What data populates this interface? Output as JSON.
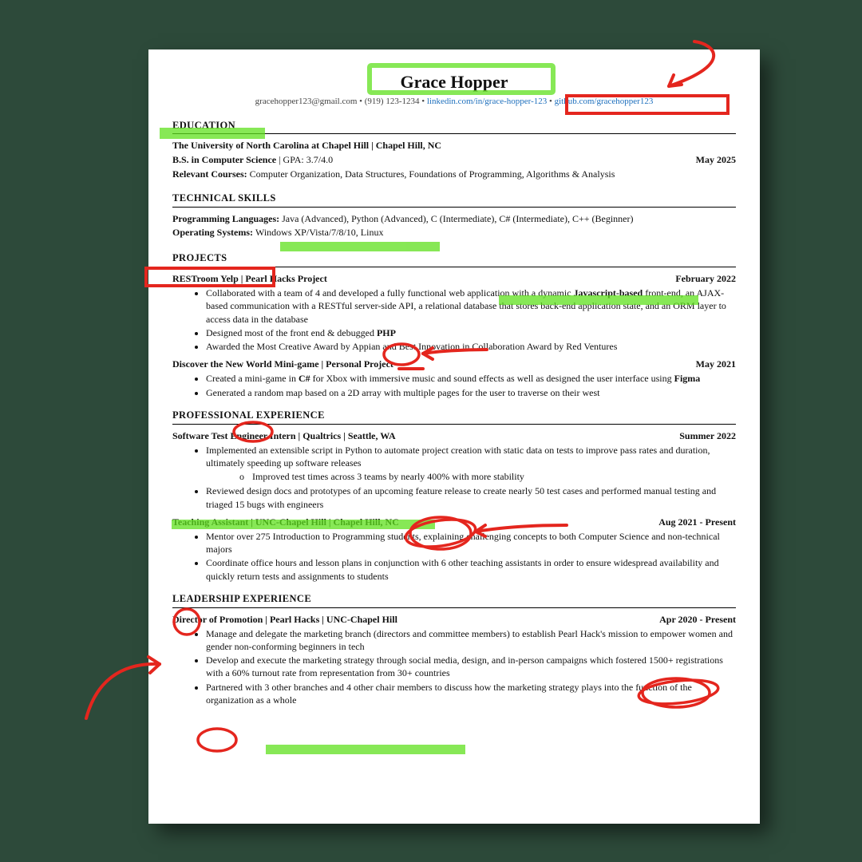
{
  "header": {
    "name": "Grace Hopper",
    "email": "gracehopper123@gmail.com",
    "phone": "(919) 123-1234",
    "linkedin_text": "linkedin.com/in/grace-hopper-123",
    "github_text": "github.com/gracehopper123",
    "sep": " • "
  },
  "sections": {
    "education": {
      "title": "EDUCATION",
      "school_line": "The University of North Carolina at Chapel Hill | Chapel Hill, NC",
      "degree_line_label": "B.S. in Computer Science",
      "gpa_label": " | GPA: ",
      "gpa_value": "3.7/4.0",
      "date": "May 2025",
      "courses_label": "Relevant Courses: ",
      "courses": "Computer Organization, Data Structures, Foundations of Programming, Algorithms & Analysis"
    },
    "skills": {
      "title": "TECHNICAL SKILLS",
      "langs_label": "Programming Languages:  ",
      "langs": "Java (Advanced), Python (Advanced), C (Intermediate), C# (Intermediate), C++ (Beginner)",
      "os_label": "Operating Systems: ",
      "os": "Windows XP/Vista/7/8/10, Linux"
    },
    "projects": {
      "title": "PROJECTS",
      "p1": {
        "heading": "RESTroom Yelp | Pearl Hacks Project",
        "date": "February 2022",
        "b1a": "Collaborated with a team of 4 and developed a fully functional web application with a dynamic ",
        "b1b_bold": "Javascript-based",
        "b1c": " front-end, an AJAX-based communication with a RESTful server-side API, a relational database that stores back-end application state, and an ORM layer to access data in the database",
        "b2a": "Designed most of the front end & debugged ",
        "b2b_bold": "PHP",
        "b3": "Awarded the Most Creative Award by Appian and Best Innovation in Collaboration Award by Red Ventures"
      },
      "p2": {
        "heading": "Discover the New World Mini-game | Personal Project",
        "date": "May 2021",
        "b1a": "Created a mini-game in ",
        "b1b_bold": "C#",
        "b1c": " for Xbox with immersive music and sound effects as well as designed the user interface using ",
        "b1d_bold": "Figma",
        "b2": "Generated a random map based on a 2D array with multiple pages for the user to traverse on their west"
      }
    },
    "experience": {
      "title": "PROFESSIONAL EXPERIENCE",
      "e1": {
        "heading": "Software Test Engineer Intern | Qualtrics | Seattle, WA",
        "date": "Summer 2022",
        "b1": "Implemented an extensible script in Python to automate project creation with static data on tests to improve pass rates and duration, ultimately speeding up software releases",
        "b1_sub": "Improved test times across 3 teams by nearly 400% with more stability",
        "b2": "Reviewed design docs and prototypes of an upcoming feature release to create nearly 50 test cases and performed manual testing and triaged 15 bugs with engineers"
      },
      "e2": {
        "heading": "Teaching Assistant | UNC-Chapel Hill | Chapel Hill, NC",
        "date": "Aug 2021 - Present",
        "b1": "Mentor over 275 Introduction to Programming students, explaining challenging concepts to both Computer Science and non-technical majors",
        "b2": "Coordinate office hours and lesson plans in conjunction with 6 other teaching assistants in order to ensure widespread availability and quickly return tests and assignments to students"
      }
    },
    "leadership": {
      "title": "LEADERSHIP EXPERIENCE",
      "l1": {
        "heading": "Director of Promotion | Pearl Hacks | UNC-Chapel Hill",
        "date": "Apr 2020 - Present",
        "b1": "Manage and delegate the marketing branch (directors and committee members) to establish Pearl Hack's mission to empower women and gender non-conforming beginners in tech",
        "b2": "Develop and execute the marketing strategy through social media, design, and in-person campaigns which fostered 1500+ registrations with a 60% turnout rate from representation from 30+ countries",
        "b3": "Partnered with 3 other branches and 4 other chair members to discuss how the marketing strategy plays into the function of the organization as a whole"
      }
    }
  }
}
